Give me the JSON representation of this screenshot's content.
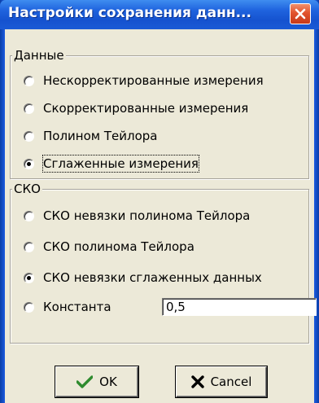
{
  "window": {
    "title": "Настройки сохранения данн...",
    "close_icon": "close-icon"
  },
  "data_group": {
    "caption": "Данные",
    "options": [
      {
        "label": "Нескорректированные измерения",
        "checked": false
      },
      {
        "label": "Скорректированные измерения",
        "checked": false
      },
      {
        "label": "Полином Тейлора",
        "checked": false
      },
      {
        "label": "Сглаженные измерения",
        "checked": true
      }
    ]
  },
  "sko_group": {
    "caption": "СКО",
    "options": [
      {
        "label": "СКО невязки полинома Тейлора",
        "checked": false
      },
      {
        "label": "СКО полинома Тейлора",
        "checked": false
      },
      {
        "label": "СКО невязки сглаженных данных",
        "checked": true
      },
      {
        "label": "Константа",
        "checked": false
      }
    ],
    "constant_value": "0,5"
  },
  "buttons": {
    "ok_label": "OK",
    "cancel_label": "Cancel",
    "ok_icon": "checkmark-icon",
    "cancel_icon": "cross-icon",
    "ok_icon_color": "#2e8b2e",
    "cancel_icon_color": "#000000"
  }
}
